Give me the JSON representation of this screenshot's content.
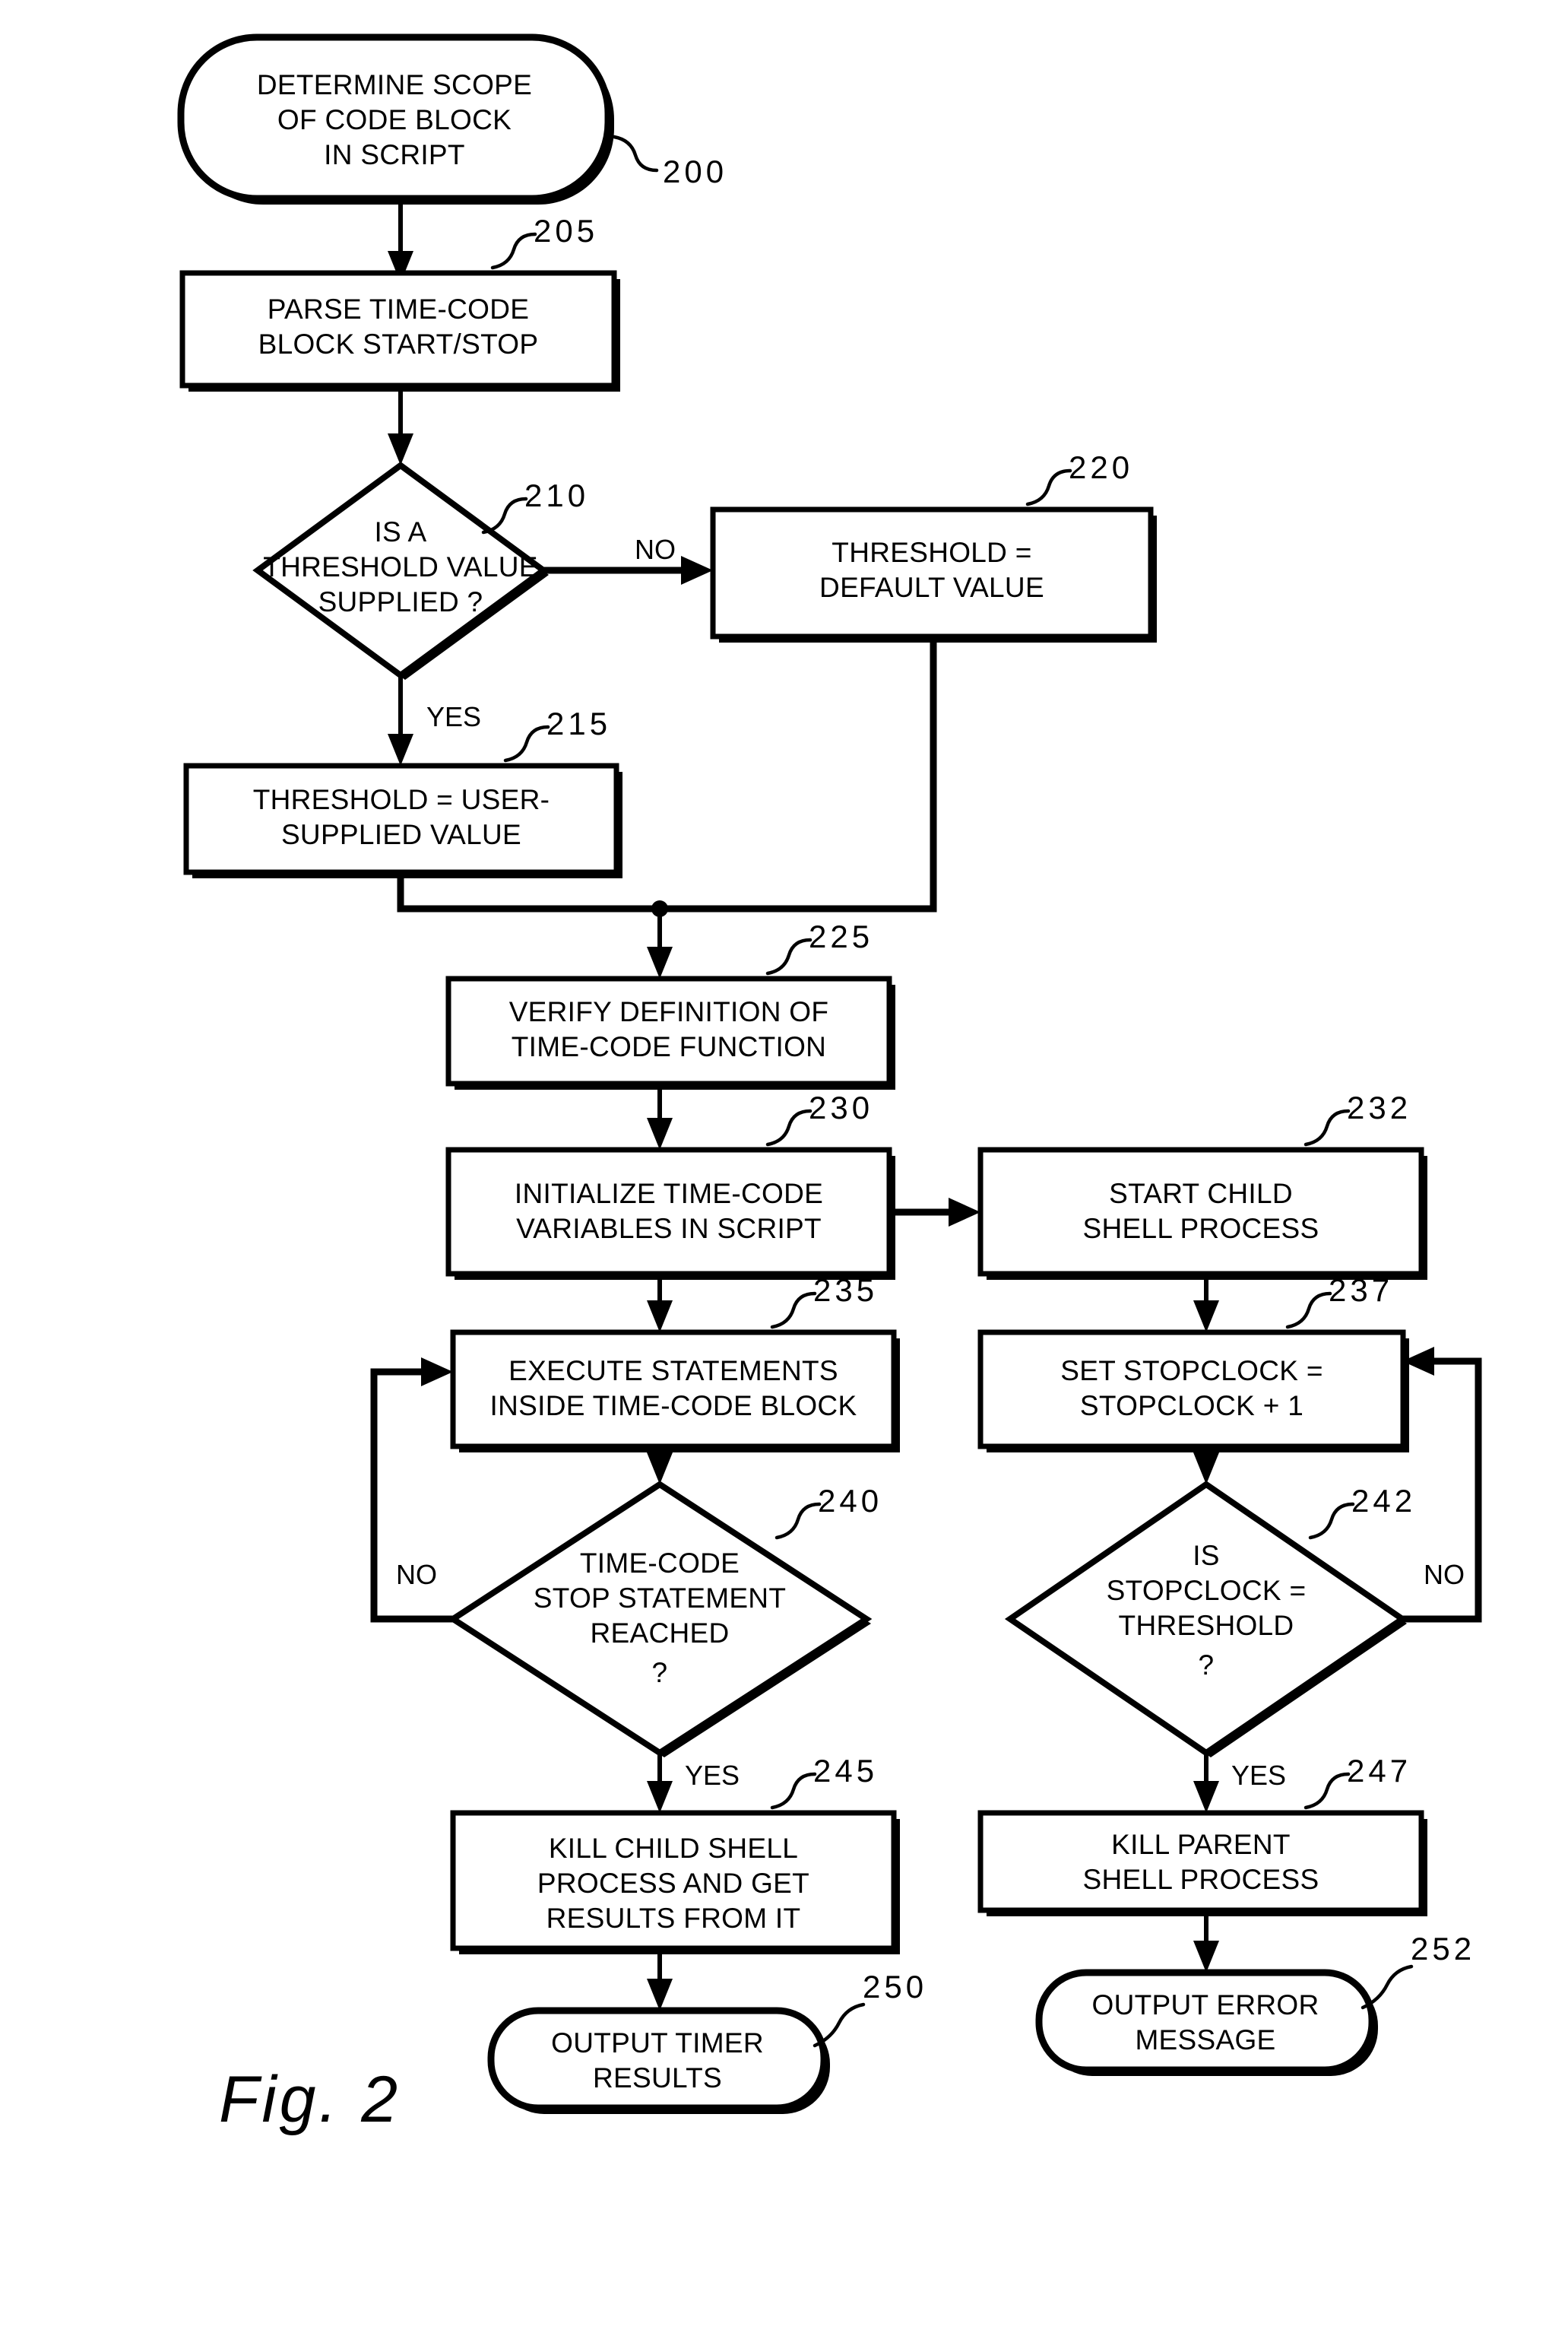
{
  "figure": {
    "caption": "Fig. 2",
    "title": "Flowchart of time-code block processing"
  },
  "nodes": [
    {
      "id": "n200",
      "ref": "200",
      "shape": "terminal",
      "lines": [
        "DETERMINE SCOPE",
        "OF CODE BLOCK",
        "IN SCRIPT"
      ]
    },
    {
      "id": "n205",
      "ref": "205",
      "shape": "process",
      "lines": [
        "PARSE TIME-CODE",
        "BLOCK START/STOP"
      ]
    },
    {
      "id": "n210",
      "ref": "210",
      "shape": "decision",
      "lines": [
        "IS A",
        "THRESHOLD VALUE",
        "SUPPLIED ?"
      ]
    },
    {
      "id": "n215",
      "ref": "215",
      "shape": "process",
      "lines": [
        "THRESHOLD = USER-",
        "SUPPLIED VALUE"
      ]
    },
    {
      "id": "n220",
      "ref": "220",
      "shape": "process",
      "lines": [
        "THRESHOLD =",
        "DEFAULT VALUE"
      ]
    },
    {
      "id": "n225",
      "ref": "225",
      "shape": "process",
      "lines": [
        "VERIFY DEFINITION OF",
        "TIME-CODE FUNCTION"
      ]
    },
    {
      "id": "n230",
      "ref": "230",
      "shape": "process",
      "lines": [
        "INITIALIZE TIME-CODE",
        "VARIABLES IN SCRIPT"
      ]
    },
    {
      "id": "n232",
      "ref": "232",
      "shape": "process",
      "lines": [
        "START CHILD",
        "SHELL PROCESS"
      ]
    },
    {
      "id": "n235",
      "ref": "235",
      "shape": "process",
      "lines": [
        "EXECUTE STATEMENTS",
        "INSIDE TIME-CODE BLOCK"
      ]
    },
    {
      "id": "n237",
      "ref": "237",
      "shape": "process",
      "lines": [
        "SET STOPCLOCK =",
        "STOPCLOCK + 1"
      ]
    },
    {
      "id": "n240",
      "ref": "240",
      "shape": "decision",
      "lines": [
        "TIME-CODE",
        "STOP STATEMENT",
        "REACHED",
        "?"
      ]
    },
    {
      "id": "n242",
      "ref": "242",
      "shape": "decision",
      "lines": [
        "IS",
        "STOPCLOCK =",
        "THRESHOLD",
        "?"
      ]
    },
    {
      "id": "n245",
      "ref": "245",
      "shape": "process",
      "lines": [
        "KILL CHILD SHELL",
        "PROCESS AND GET",
        "RESULTS FROM IT"
      ]
    },
    {
      "id": "n247",
      "ref": "247",
      "shape": "process",
      "lines": [
        "KILL PARENT",
        "SHELL PROCESS"
      ]
    },
    {
      "id": "n250",
      "ref": "250",
      "shape": "terminal",
      "lines": [
        "OUTPUT TIMER",
        "RESULTS"
      ]
    },
    {
      "id": "n252",
      "ref": "252",
      "shape": "terminal",
      "lines": [
        "OUTPUT ERROR",
        "MESSAGE"
      ]
    }
  ],
  "branch_labels": {
    "d210_no": "NO",
    "d210_yes": "YES",
    "d240_no": "NO",
    "d240_yes": "YES",
    "d242_no": "NO",
    "d242_yes": "YES"
  },
  "colors": {
    "stroke": "#000000",
    "fill": "#ffffff",
    "background": "#ffffff"
  }
}
